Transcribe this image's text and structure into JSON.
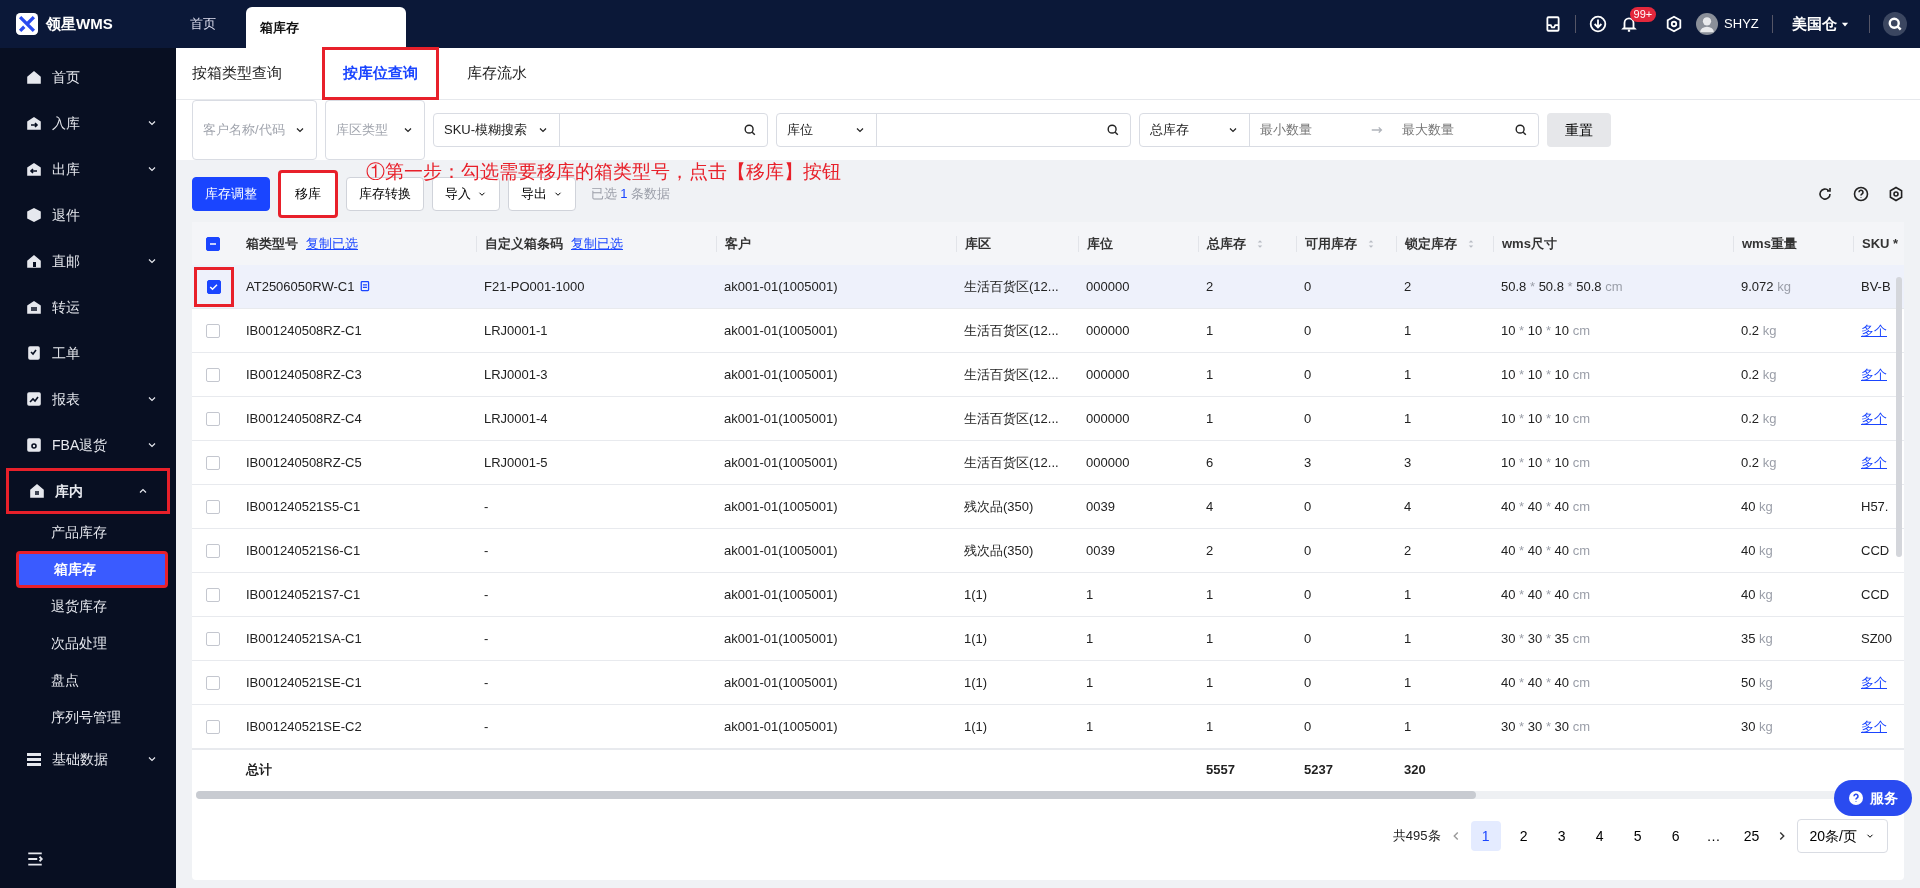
{
  "header": {
    "logo_text": "领星WMS",
    "tabs": [
      {
        "label": "首页",
        "selected": false
      },
      {
        "label": "箱库存",
        "selected": true
      }
    ],
    "notification_count": "99+",
    "user": "SHYZ",
    "warehouse": "美国仓"
  },
  "sidebar": {
    "items": [
      {
        "label": "首页"
      },
      {
        "label": "入库",
        "expanded": false
      },
      {
        "label": "出库",
        "expanded": false
      },
      {
        "label": "退件"
      },
      {
        "label": "直邮",
        "expanded": false
      },
      {
        "label": "转运"
      },
      {
        "label": "工单"
      },
      {
        "label": "报表",
        "expanded": false
      },
      {
        "label": "FBA退货",
        "expanded": false
      },
      {
        "label": "库内",
        "expanded": true,
        "annotated": true,
        "children": [
          {
            "label": "产品库存",
            "selected": false
          },
          {
            "label": "箱库存",
            "selected": true,
            "annotated": true
          },
          {
            "label": "退货库存",
            "selected": false
          },
          {
            "label": "次品处理",
            "selected": false
          },
          {
            "label": "盘点",
            "selected": false
          },
          {
            "label": "序列号管理",
            "selected": false
          }
        ]
      },
      {
        "label": "基础数据",
        "expanded": false
      }
    ]
  },
  "subtabs": [
    {
      "label": "按箱类型查询",
      "selected": false
    },
    {
      "label": "按库位查询",
      "selected": true,
      "annotated": true
    },
    {
      "label": "库存流水",
      "selected": false
    }
  ],
  "filters": [
    {
      "kind": "select",
      "placeholder": "客户名称/代码"
    },
    {
      "kind": "select",
      "placeholder": "库区类型"
    },
    {
      "kind": "select-search",
      "value": "SKU-模糊搜索"
    },
    {
      "kind": "select-search",
      "value": "库位"
    },
    {
      "kind": "range",
      "value": "总库存",
      "min_placeholder": "最小数量",
      "max_placeholder": "最大数量"
    }
  ],
  "reset_button": "重置",
  "annotation": "①第一步：勾选需要移库的箱类型号，点击【移库】按钮",
  "toolbar": [
    {
      "label": "库存调整",
      "kind": "primary"
    },
    {
      "label": "移库",
      "kind": "default",
      "annotated": true
    },
    {
      "label": "库存转换",
      "kind": "default"
    },
    {
      "label": "导入",
      "kind": "dropdown"
    },
    {
      "label": "导出",
      "kind": "dropdown"
    }
  ],
  "selection": {
    "prefix": "已选",
    "count": "1",
    "suffix": "条数据"
  },
  "table": {
    "select_all": {
      "indeterminate": true
    },
    "columns": [
      {
        "label": "箱类型号",
        "link": "复制已选"
      },
      {
        "label": "自定义箱条码",
        "link": "复制已选"
      },
      {
        "label": "客户"
      },
      {
        "label": "库区"
      },
      {
        "label": "库位"
      },
      {
        "label": "总库存",
        "sortable": true
      },
      {
        "label": "可用库存",
        "sortable": true
      },
      {
        "label": "锁定库存",
        "sortable": true
      },
      {
        "label": "wms尺寸"
      },
      {
        "label": "wms重量"
      },
      {
        "label": "SKU *"
      }
    ],
    "rows": [
      {
        "selected": true,
        "annotated": true,
        "box": "AT2506050RW-C1",
        "code": "F21-PO001-1000",
        "customer": "ak001-01(1005001)",
        "zone": "生活百货区(12...",
        "location": "000000",
        "total": "2",
        "available": "0",
        "locked": "2",
        "size": "50.8 * 50.8 * 50.8",
        "size_unit": "cm",
        "weight": "9.072",
        "weight_unit": "kg",
        "sku": "BV-B",
        "sku_link": false
      },
      {
        "selected": false,
        "box": "IB001240508RZ-C1",
        "code": "LRJ0001-1",
        "customer": "ak001-01(1005001)",
        "zone": "生活百货区(12...",
        "location": "000000",
        "total": "1",
        "available": "0",
        "locked": "1",
        "size": "10 * 10 * 10",
        "size_unit": "cm",
        "weight": "0.2",
        "weight_unit": "kg",
        "sku": "多个",
        "sku_link": true
      },
      {
        "selected": false,
        "box": "IB001240508RZ-C3",
        "code": "LRJ0001-3",
        "customer": "ak001-01(1005001)",
        "zone": "生活百货区(12...",
        "location": "000000",
        "total": "1",
        "available": "0",
        "locked": "1",
        "size": "10 * 10 * 10",
        "size_unit": "cm",
        "weight": "0.2",
        "weight_unit": "kg",
        "sku": "多个",
        "sku_link": true
      },
      {
        "selected": false,
        "box": "IB001240508RZ-C4",
        "code": "LRJ0001-4",
        "customer": "ak001-01(1005001)",
        "zone": "生活百货区(12...",
        "location": "000000",
        "total": "1",
        "available": "0",
        "locked": "1",
        "size": "10 * 10 * 10",
        "size_unit": "cm",
        "weight": "0.2",
        "weight_unit": "kg",
        "sku": "多个",
        "sku_link": true
      },
      {
        "selected": false,
        "box": "IB001240508RZ-C5",
        "code": "LRJ0001-5",
        "customer": "ak001-01(1005001)",
        "zone": "生活百货区(12...",
        "location": "000000",
        "total": "6",
        "available": "3",
        "locked": "3",
        "size": "10 * 10 * 10",
        "size_unit": "cm",
        "weight": "0.2",
        "weight_unit": "kg",
        "sku": "多个",
        "sku_link": true
      },
      {
        "selected": false,
        "box": "IB001240521S5-C1",
        "code": "-",
        "customer": "ak001-01(1005001)",
        "zone": "残次品(350)",
        "location": "0039",
        "total": "4",
        "available": "0",
        "locked": "4",
        "size": "40 * 40 * 40",
        "size_unit": "cm",
        "weight": "40",
        "weight_unit": "kg",
        "sku": "H57.",
        "sku_link": false
      },
      {
        "selected": false,
        "box": "IB001240521S6-C1",
        "code": "-",
        "customer": "ak001-01(1005001)",
        "zone": "残次品(350)",
        "location": "0039",
        "total": "2",
        "available": "0",
        "locked": "2",
        "size": "40 * 40 * 40",
        "size_unit": "cm",
        "weight": "40",
        "weight_unit": "kg",
        "sku": "CCD",
        "sku_link": false
      },
      {
        "selected": false,
        "box": "IB001240521S7-C1",
        "code": "-",
        "customer": "ak001-01(1005001)",
        "zone": "1(1)",
        "location": "1",
        "total": "1",
        "available": "0",
        "locked": "1",
        "size": "40 * 40 * 40",
        "size_unit": "cm",
        "weight": "40",
        "weight_unit": "kg",
        "sku": "CCD",
        "sku_link": false
      },
      {
        "selected": false,
        "box": "IB001240521SA-C1",
        "code": "-",
        "customer": "ak001-01(1005001)",
        "zone": "1(1)",
        "location": "1",
        "total": "1",
        "available": "0",
        "locked": "1",
        "size": "30 * 30 * 35",
        "size_unit": "cm",
        "weight": "35",
        "weight_unit": "kg",
        "sku": "SZ00",
        "sku_link": false
      },
      {
        "selected": false,
        "box": "IB001240521SE-C1",
        "code": "-",
        "customer": "ak001-01(1005001)",
        "zone": "1(1)",
        "location": "1",
        "total": "1",
        "available": "0",
        "locked": "1",
        "size": "40 * 40 * 40",
        "size_unit": "cm",
        "weight": "50",
        "weight_unit": "kg",
        "sku": "多个",
        "sku_link": true
      },
      {
        "selected": false,
        "box": "IB001240521SE-C2",
        "code": "-",
        "customer": "ak001-01(1005001)",
        "zone": "1(1)",
        "location": "1",
        "total": "1",
        "available": "0",
        "locked": "1",
        "size": "30 * 30 * 30",
        "size_unit": "cm",
        "weight": "30",
        "weight_unit": "kg",
        "sku": "多个",
        "sku_link": true
      }
    ],
    "totals": {
      "label": "总计",
      "total": "5557",
      "available": "5237",
      "locked": "320"
    }
  },
  "pagination": {
    "summary": "共495条",
    "pages": [
      {
        "label": "1",
        "selected": true
      },
      {
        "label": "2",
        "selected": false
      },
      {
        "label": "3",
        "selected": false
      },
      {
        "label": "4",
        "selected": false
      },
      {
        "label": "5",
        "selected": false
      },
      {
        "label": "6",
        "selected": false
      },
      {
        "label": "…",
        "selected": false
      },
      {
        "label": "25",
        "selected": false
      }
    ],
    "page_size": "20条/页"
  },
  "service_button": "服务"
}
